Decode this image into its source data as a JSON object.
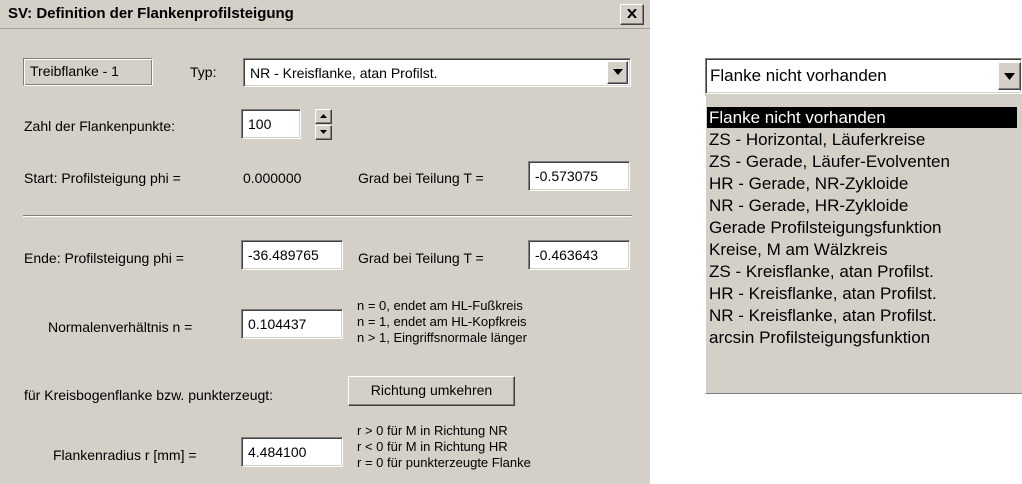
{
  "window": {
    "title": "SV: Definition der Flankenprofilsteigung"
  },
  "header": {
    "flank_label": "Treibflanke - 1",
    "type_label": "Typ:",
    "type_value": "NR - Kreisflanke, atan Profilst."
  },
  "points": {
    "label": "Zahl der Flankenpunkte:",
    "value": "100"
  },
  "start": {
    "label": "Start:  Profilsteigung phi =",
    "phi_value": "0.000000",
    "grad_label": "Grad bei Teilung T =",
    "grad_value": "-0.573075"
  },
  "end": {
    "label": "Ende: Profilsteigung phi =",
    "phi_value": "-36.489765",
    "grad_label": "Grad bei Teilung T =",
    "grad_value": "-0.463643"
  },
  "normal_ratio": {
    "label": "Normalenverhältnis n =",
    "value": "0.104437",
    "notes": [
      "n = 0, endet am HL-Fußkreis",
      "n = 1, endet am HL-Kopfkreis",
      "n > 1, Eingriffsnormale länger"
    ]
  },
  "direction": {
    "label": "für Kreisbogenflanke bzw. punkterzeugt:",
    "button_label": "Richtung umkehren"
  },
  "radius": {
    "label": "Flankenradius r [mm] =",
    "value": "4.484100",
    "notes": [
      "r > 0  für M in Richtung NR",
      "r < 0  für M in Richtung HR",
      "r = 0 für punkterzeugte Flanke"
    ]
  },
  "dropdown": {
    "selected_value": "Flanke nicht vorhanden",
    "options": [
      "Flanke nicht vorhanden",
      "ZS - Horizontal, Läuferkreise",
      "ZS - Gerade, Läufer-Evolventen",
      "HR - Gerade, NR-Zykloide",
      "NR - Gerade, HR-Zykloide",
      "Gerade Profilsteigungsfunktion",
      "Kreise, M am Wälzkreis",
      "ZS - Kreisflanke, atan Profilst.",
      "HR - Kreisflanke, atan Profilst.",
      "NR - Kreisflanke, atan Profilst.",
      "arcsin Profilsteigungsfunktion"
    ],
    "highlighted_index": 0
  },
  "icons": {
    "close": "close-icon",
    "dropdown": "chevron-down-icon",
    "spin_up": "spin-up-icon",
    "spin_down": "spin-down-icon"
  }
}
